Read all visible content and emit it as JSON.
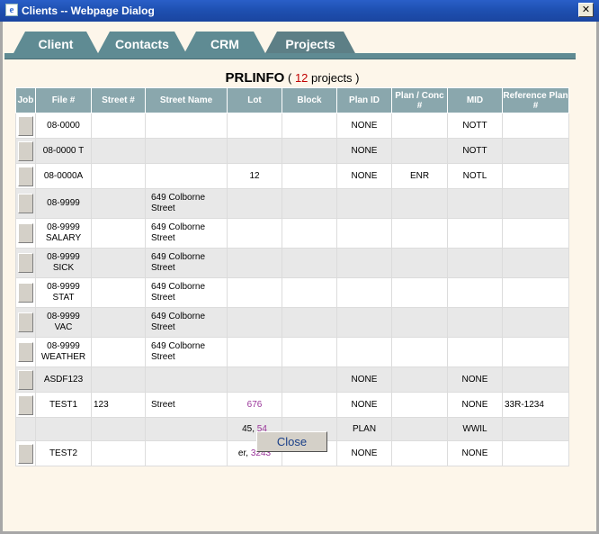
{
  "window": {
    "title": "Clients -- Webpage Dialog",
    "close_glyph": "✕"
  },
  "tabs": [
    {
      "label": "Client"
    },
    {
      "label": "Contacts"
    },
    {
      "label": "CRM"
    },
    {
      "label": "Projects"
    }
  ],
  "heading": {
    "title": "PRLINFO",
    "open_paren": "(",
    "count": "12",
    "suffix": "projects )"
  },
  "table": {
    "headers": [
      "Job",
      "File #",
      "Street #",
      "Street Name",
      "Lot",
      "Block",
      "Plan ID",
      "Plan / Conc #",
      "MID",
      "Reference Plan #"
    ],
    "rows": [
      {
        "file": "08-0000",
        "street_no": "",
        "street": "",
        "lot": "",
        "lot_link": "",
        "block": "",
        "plan": "NONE",
        "conc": "",
        "mid": "NOTT",
        "ref": ""
      },
      {
        "file": "08-0000 T",
        "street_no": "",
        "street": "",
        "lot": "",
        "lot_link": "",
        "block": "",
        "plan": "NONE",
        "conc": "",
        "mid": "NOTT",
        "ref": ""
      },
      {
        "file": "08-0000A",
        "street_no": "",
        "street": "",
        "lot": "12",
        "lot_link": "",
        "block": "",
        "plan": "NONE",
        "conc": "ENR",
        "mid": "NOTL",
        "ref": ""
      },
      {
        "file": "08-9999",
        "street_no": "",
        "street": "649 Colborne Street",
        "lot": "",
        "lot_link": "",
        "block": "",
        "plan": "",
        "conc": "",
        "mid": "",
        "ref": ""
      },
      {
        "file": "08-9999 SALARY",
        "street_no": "",
        "street": "649 Colborne Street",
        "lot": "",
        "lot_link": "",
        "block": "",
        "plan": "",
        "conc": "",
        "mid": "",
        "ref": ""
      },
      {
        "file": "08-9999 SICK",
        "street_no": "",
        "street": "649 Colborne Street",
        "lot": "",
        "lot_link": "",
        "block": "",
        "plan": "",
        "conc": "",
        "mid": "",
        "ref": ""
      },
      {
        "file": "08-9999 STAT",
        "street_no": "",
        "street": "649 Colborne Street",
        "lot": "",
        "lot_link": "",
        "block": "",
        "plan": "",
        "conc": "",
        "mid": "",
        "ref": ""
      },
      {
        "file": "08-9999 VAC",
        "street_no": "",
        "street": "649 Colborne Street",
        "lot": "",
        "lot_link": "",
        "block": "",
        "plan": "",
        "conc": "",
        "mid": "",
        "ref": ""
      },
      {
        "file": "08-9999 WEATHER",
        "street_no": "",
        "street": "649 Colborne Street",
        "lot": "",
        "lot_link": "",
        "block": "",
        "plan": "",
        "conc": "",
        "mid": "",
        "ref": ""
      },
      {
        "file": "ASDF123",
        "street_no": "",
        "street": "",
        "lot": "",
        "lot_link": "",
        "block": "",
        "plan": "NONE",
        "conc": "",
        "mid": "NONE",
        "ref": ""
      },
      {
        "file": "TEST1",
        "street_no": "123",
        "street": "Street",
        "lot": "",
        "lot_link": "676",
        "block": "",
        "plan": "NONE",
        "conc": "",
        "mid": "NONE",
        "ref": "33R-1234"
      },
      {
        "no_button": true,
        "file": "",
        "street_no": "",
        "street": "",
        "lot": "45,",
        "lot_link": "54",
        "block": "",
        "plan": "PLAN",
        "conc": "",
        "mid": "WWIL",
        "ref": ""
      },
      {
        "file": "TEST2",
        "street_no": "",
        "street": "",
        "lot": "er,",
        "lot_link": "3243",
        "block": "",
        "plan": "NONE",
        "conc": "",
        "mid": "NONE",
        "ref": ""
      }
    ]
  },
  "buttons": {
    "close": "Close"
  }
}
